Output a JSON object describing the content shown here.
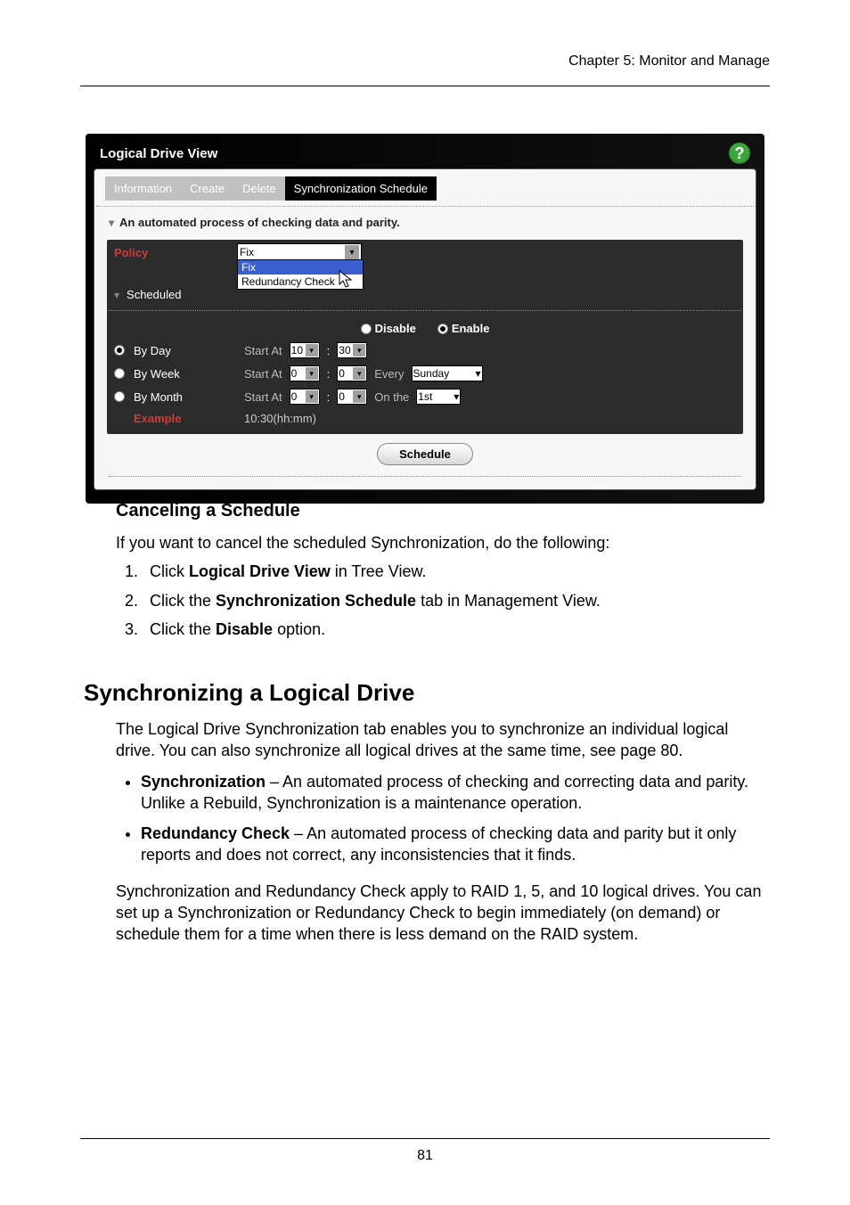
{
  "chapter": "Chapter 5: Monitor and Manage",
  "app": {
    "title": "Logical Drive View",
    "help": "?",
    "tabs": [
      "Information",
      "Create",
      "Delete",
      "Synchronization Schedule"
    ],
    "active_tab_index": 3,
    "description": "An automated process of checking data and parity.",
    "policy": {
      "label": "Policy",
      "value": "Fix",
      "options": [
        "Fix",
        "Redundancy Check"
      ],
      "highlight_index": 0
    },
    "scheduled_label": "Scheduled",
    "radio": {
      "disable": "Disable",
      "enable": "Enable",
      "selected": "enable"
    },
    "rows": {
      "by_day": {
        "label": "By Day",
        "start_at": "Start At",
        "hour": "10",
        "min": "30"
      },
      "by_week": {
        "label": "By Week",
        "start_at": "Start At",
        "hour": "0",
        "min": "0",
        "every": "Every",
        "day": "Sunday"
      },
      "by_month": {
        "label": "By Month",
        "start_at": "Start At",
        "hour": "0",
        "min": "0",
        "on_the": "On the",
        "day": "1st"
      }
    },
    "example_label": "Example",
    "example_value": "10:30(hh:mm)",
    "schedule_btn": "Schedule"
  },
  "doc": {
    "h3": "Canceling a Schedule",
    "p1": "If you want to cancel the scheduled Synchronization, do the following:",
    "steps": {
      "s1a": "Click ",
      "s1b": "Logical Drive View",
      "s1c": " in Tree View.",
      "s2a": "Click the ",
      "s2b": "Synchronization Schedule",
      "s2c": " tab in Management View.",
      "s3a": "Click the ",
      "s3b": "Disable",
      "s3c": " option."
    },
    "h2": "Synchronizing a Logical Drive",
    "p2": "The Logical Drive Synchronization tab enables you to synchronize an individual logical drive. You can also synchronize all logical drives at the same time, see page 80.",
    "b1a": "Synchronization",
    "b1b": " – An automated process of checking and correcting data and parity. Unlike a Rebuild, Synchronization is a maintenance operation.",
    "b2a": "Redundancy Check",
    "b2b": " – An automated process of checking data and parity but it only reports and does not correct, any inconsistencies that it finds.",
    "p3": "Synchronization and Redundancy Check apply to RAID 1, 5, and 10 logical drives. You can set up a Synchronization or Redundancy Check to begin immediately (on demand) or schedule them for a time when there is less demand on the RAID system."
  },
  "page_number": "81"
}
